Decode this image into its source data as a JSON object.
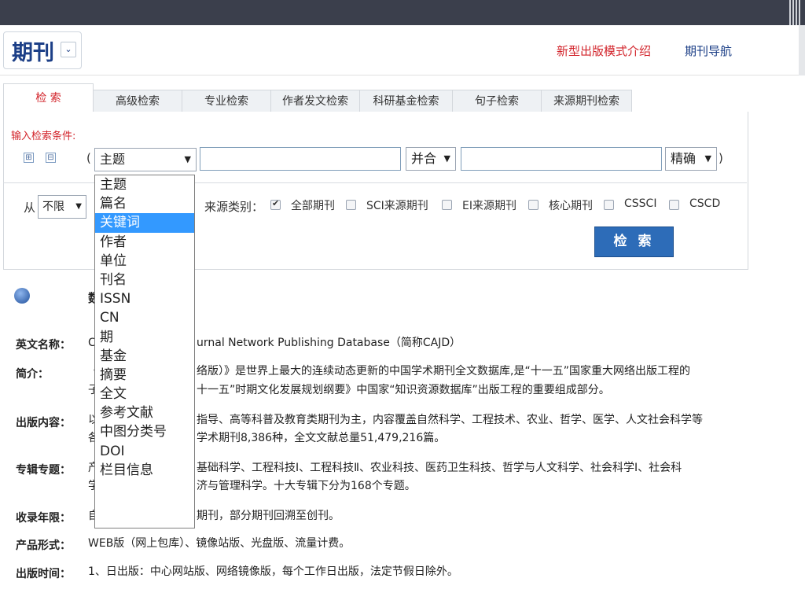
{
  "header": {
    "logo": "期刊",
    "logo_dd": "⌄",
    "links": [
      "新型出版模式介绍",
      "期刊导航"
    ]
  },
  "tabs": [
    "检 索",
    "高级检索",
    "专业检索",
    "作者发文检索",
    "科研基金检索",
    "句子检索",
    "来源期刊检索"
  ],
  "search": {
    "condition_label": "输入检索条件:",
    "plus": "⊞",
    "minus": "⊟",
    "open_paren": "(",
    "close_paren": ")",
    "field": "主题",
    "logic": "并合",
    "match": "精确",
    "from_label": "从",
    "from_value": "不限",
    "source_label": "来源类别：",
    "checkboxes": [
      {
        "label": "全部期刊",
        "checked": true
      },
      {
        "label": "SCI来源期刊",
        "checked": false
      },
      {
        "label": "EI来源期刊",
        "checked": false
      },
      {
        "label": "核心期刊",
        "checked": false
      },
      {
        "label": "CSSCI",
        "checked": false
      },
      {
        "label": "CSCD",
        "checked": false
      }
    ],
    "search_button": "检 索"
  },
  "dropdown": {
    "options": [
      "主题",
      "篇名",
      "关键词",
      "作者",
      "单位",
      "刊名",
      "ISSN",
      "CN",
      "期",
      "基金",
      "摘要",
      "全文",
      "参考文献",
      "中图分类号",
      "DOI",
      "栏目信息"
    ],
    "highlighted": "关键词"
  },
  "info": {
    "title_fragment": "数",
    "rows": [
      {
        "label": "英文名称：",
        "lines": [
          "C",
          "urnal Network Publishing Database（简称CAJD）"
        ]
      },
      {
        "label": "简介：",
        "lines": [
          "《",
          "络版）》是世界上最大的连续动态更新的中国学术期刊全文数据库,是“十一五”国家重大网络出版工程的",
          "子",
          "十一五”时期文化发展规划纲要》中国家“知识资源数据库”出版工程的重要组成部分。"
        ]
      },
      {
        "label": "出版内容：",
        "lines": [
          "以",
          "指导、高等科普及教育类期刊为主，内容覆盖自然科学、工程技术、农业、哲学、医学、人文社会科学等",
          "各",
          "学术期刊8,386种，全文文献总量51,479,216篇。"
        ]
      },
      {
        "label": "专辑专题：",
        "lines": [
          "产",
          "基础科学、工程科技Ⅰ、工程科技Ⅱ、农业科技、医药卫生科技、哲学与人文科学、社会科学Ⅰ、社会科",
          "学",
          "济与管理科学。十大专辑下分为168个专题。"
        ]
      },
      {
        "label": "收录年限：",
        "lines": [
          "自",
          "期刊，部分期刊回溯至创刊。"
        ]
      },
      {
        "label": "产品形式：",
        "lines": [
          "WEB版（网上包库）、镜像站版、光盘版、流量计费。"
        ]
      },
      {
        "label": "出版时间：",
        "lines": [
          "1、日出版：中心网站版、网络镜像版，每个工作日出版，法定节假日除外。"
        ]
      }
    ]
  }
}
